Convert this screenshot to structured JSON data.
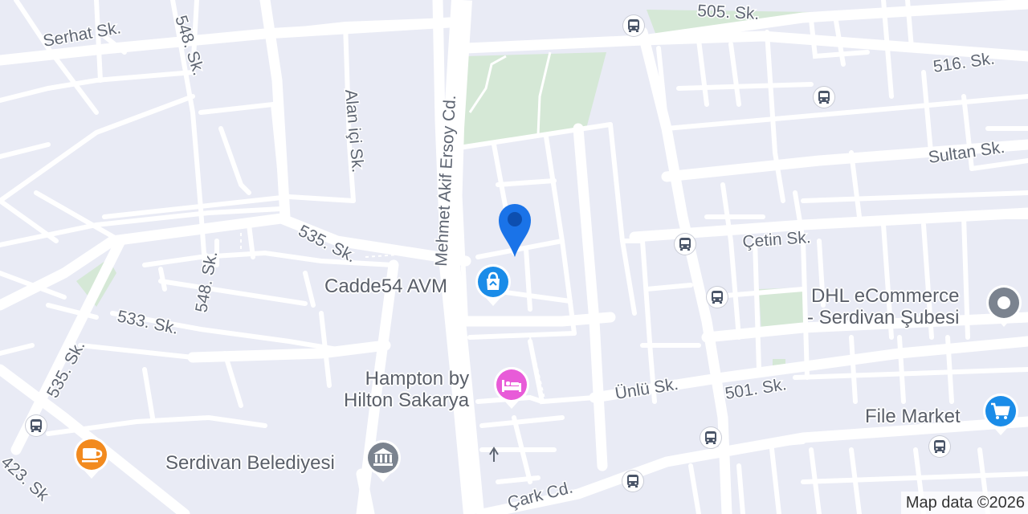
{
  "map": {
    "background_color": "#e9ebf5",
    "road_color": "#ffffff",
    "park_color": "#d5e8d6",
    "streets": [
      "505. Sk.",
      "Serhat Sk.",
      "548. Sk.",
      "516. Sk.",
      "Alan içi Sk.",
      "Mehmet Akif Ersoy Cd.",
      "Sultan Sk.",
      "535. Sk.",
      "Çetin Sk.",
      "548. Sk.",
      "533. Sk.",
      "535. Sk.",
      "Ünlü Sk.",
      "501. Sk.",
      "423. Sk",
      "Çark Cd."
    ],
    "pois": {
      "cadde54": {
        "label": "Cadde54 AVM",
        "icon": "shopping-bag-icon",
        "color": "#1a8ce8"
      },
      "dhl": {
        "label_line1": "DHL eCommerce",
        "label_line2": "- Serdivan Şubesi",
        "icon": "location-dot-icon",
        "color": "#7b838f"
      },
      "hampton": {
        "label_line1": "Hampton by",
        "label_line2": "Hilton Sakarya",
        "icon": "bed-icon",
        "color": "#e85bd8"
      },
      "file_market": {
        "label": "File Market",
        "icon": "shopping-cart-icon",
        "color": "#1a8ce8"
      },
      "belediye": {
        "label": "Serdivan Belediyesi",
        "icon": "government-building-icon",
        "color": "#7b838f"
      },
      "cafe": {
        "icon": "coffee-cup-icon",
        "color": "#f28a1e"
      }
    },
    "current_location": {
      "icon": "map-marker-icon",
      "color": "#1a73e8"
    },
    "bus_stop_icon": "bus-icon",
    "copyright": "Map data ©2026"
  }
}
